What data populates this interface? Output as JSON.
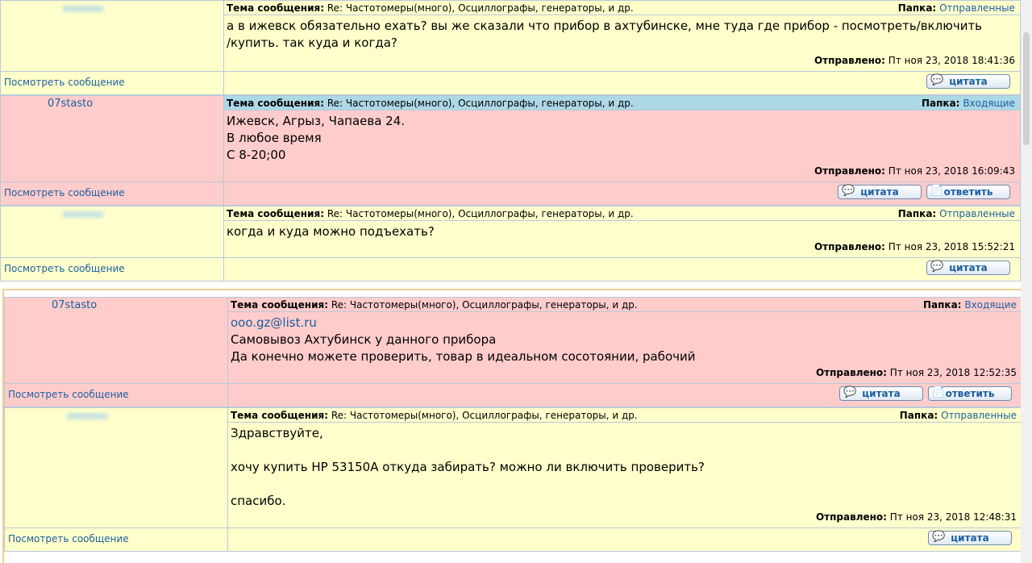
{
  "labels": {
    "subject": "Тема сообщения:",
    "folder": "Папка:",
    "sent": "Отправлено:",
    "view": "Посмотреть сообщение",
    "quote": "цитата",
    "reply": "ответить"
  },
  "messages": [
    {
      "author": "",
      "subject": "Re: Частотомеры(много), Осциллографы, генераторы, и др.",
      "folder": "Отправленные",
      "body": [
        "а в ижевск обязательно ехать? вы же сказали что прибор в ахтубинске, мне туда где прибор - посмотреть/включить",
        "/купить. так куда и когда?"
      ],
      "sent": "Пт ноя 23, 2018 18:41:36"
    },
    {
      "author": "07stasto",
      "subject": "Re: Частотомеры(много), Осциллографы, генераторы, и др.",
      "folder": "Входящие",
      "body": [
        "Ижевск, Агрыз, Чапаева 24.",
        "В любое время",
        "С 8-20;00"
      ],
      "sent": "Пт ноя 23, 2018 16:09:43"
    },
    {
      "author": "",
      "subject": "Re: Частотомеры(много), Осциллографы, генераторы, и др.",
      "folder": "Отправленные",
      "body": [
        "когда и куда можно подъехать?"
      ],
      "sent": "Пт ноя 23, 2018 15:52:21"
    },
    {
      "author": "07stasto",
      "subject": "Re: Частотомеры(много), Осциллографы, генераторы, и др.",
      "folder": "Входящие",
      "email": "ooo.gz@list.ru",
      "body": [
        "Самовывоз Ахтубинск у данного прибора",
        "Да конечно можете проверить, товар в идеальном сосотоянии, рабочий"
      ],
      "sent": "Пт ноя 23, 2018 12:52:35"
    },
    {
      "author": "",
      "subject": "Re: Частотомеры(много), Осциллографы, генераторы, и др.",
      "folder": "Отправленные",
      "body": [
        "Здравствуйте,",
        "",
        "хочу купить HP 53150A откуда забирать? можно ли включить проверить?",
        "",
        "спасибо."
      ],
      "sent": "Пт ноя 23, 2018 12:48:31"
    }
  ]
}
